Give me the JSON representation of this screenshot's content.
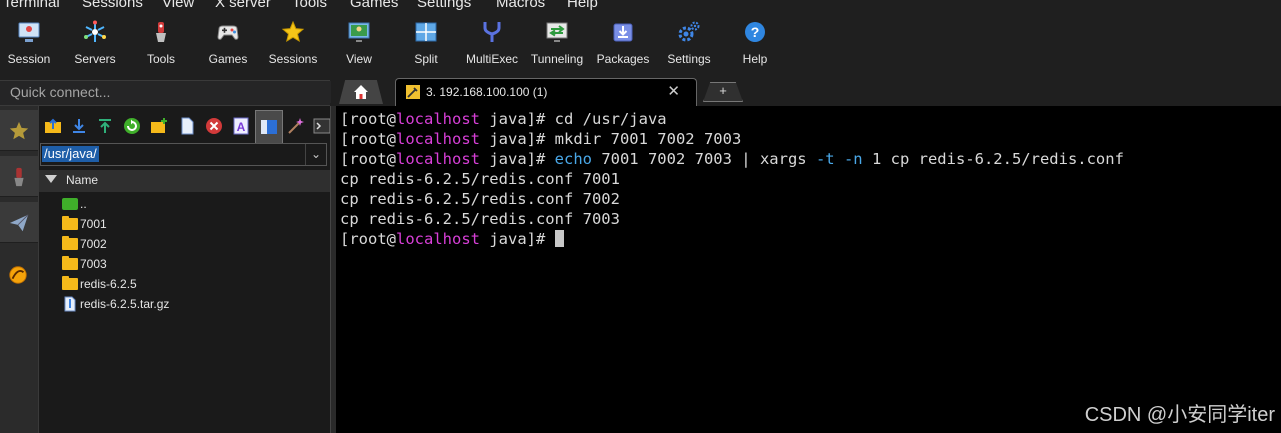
{
  "menu": [
    "Terminal",
    "Sessions",
    "View",
    "X server",
    "Tools",
    "Games",
    "Settings",
    "Macros",
    "Help"
  ],
  "toolbar": [
    {
      "label": "Session",
      "icon": "session-icon"
    },
    {
      "label": "Servers",
      "icon": "servers-icon"
    },
    {
      "label": "Tools",
      "icon": "tools-icon"
    },
    {
      "label": "Games",
      "icon": "games-icon"
    },
    {
      "label": "Sessions",
      "icon": "sessions-star-icon"
    },
    {
      "label": "View",
      "icon": "view-icon"
    },
    {
      "label": "Split",
      "icon": "split-icon"
    },
    {
      "label": "MultiExec",
      "icon": "multiexec-icon"
    },
    {
      "label": "Tunneling",
      "icon": "tunneling-icon"
    },
    {
      "label": "Packages",
      "icon": "packages-icon"
    },
    {
      "label": "Settings",
      "icon": "settings-gears-icon"
    },
    {
      "label": "Help",
      "icon": "help-icon"
    }
  ],
  "quick_connect": {
    "placeholder": "Quick connect..."
  },
  "tabs": {
    "home_icon": "home-icon",
    "active": {
      "label": "3. 192.168.100.100 (1)",
      "close": "✕"
    },
    "new_tab": "+"
  },
  "sftp": {
    "path": "/usr/java/",
    "column": "Name",
    "files": [
      {
        "name": "..",
        "type": "parent"
      },
      {
        "name": "7001",
        "type": "folder"
      },
      {
        "name": "7002",
        "type": "folder"
      },
      {
        "name": "7003",
        "type": "folder"
      },
      {
        "name": "redis-6.2.5",
        "type": "folder"
      },
      {
        "name": "redis-6.2.5.tar.gz",
        "type": "file"
      }
    ]
  },
  "terminal": {
    "prompt_user": "[root@",
    "prompt_host": "localhost",
    "prompt_tail": " java]# ",
    "lines": [
      {
        "kind": "prompt",
        "cmd": "cd /usr/java"
      },
      {
        "kind": "prompt",
        "cmd": "mkdir 7001 7002 7003"
      },
      {
        "kind": "prompt-colored",
        "p1": "echo",
        "p2": " 7001 7002 7003 | xargs ",
        "p3": "-t",
        "p4": " ",
        "p5": "-n",
        "p6": " 1 cp redis-6.2.5/redis.conf"
      },
      {
        "kind": "output",
        "text": "cp redis-6.2.5/redis.conf 7001"
      },
      {
        "kind": "output",
        "text": "cp redis-6.2.5/redis.conf 7002"
      },
      {
        "kind": "output",
        "text": "cp redis-6.2.5/redis.conf 7003"
      },
      {
        "kind": "prompt",
        "cmd": ""
      }
    ]
  },
  "watermark": "CSDN @小安同学iter",
  "colors": {
    "host": "#d83fd8",
    "keyword": "#4aa8e8",
    "folder": "#f5b91a",
    "selection": "#1e5ea8"
  }
}
